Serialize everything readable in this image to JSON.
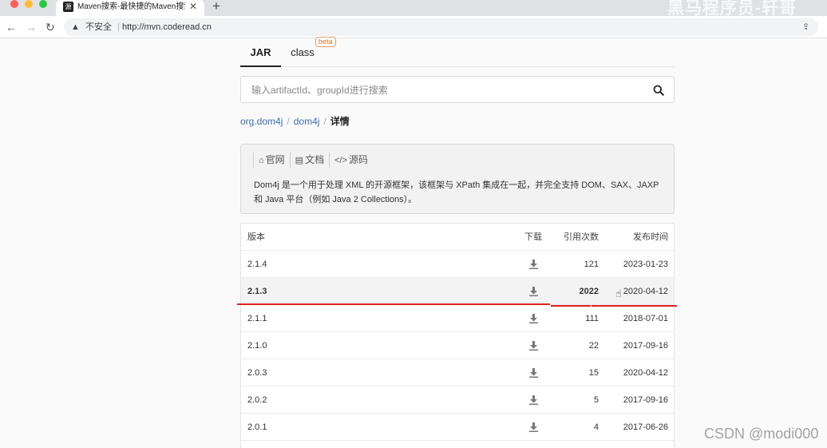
{
  "browser": {
    "tab_title": "Maven搜索-最快捷的Maven搜索",
    "tab_close": "✕",
    "new_tab": "+",
    "favicon": "源",
    "insecure_label": "不安全",
    "url": "http://mvn.coderead.cn",
    "url_sep": "|",
    "watermark_top": "黑马程序员-轩哥"
  },
  "tabs": {
    "jar": "JAR",
    "class": "class",
    "beta": "beta"
  },
  "search": {
    "placeholder": "输入artifactId、groupId进行搜索"
  },
  "breadcrumb": {
    "group": "org.dom4j",
    "sep1": "/",
    "artifact": "dom4j",
    "sep2": "/",
    "current": "详情"
  },
  "info": {
    "link_home": "官网",
    "link_docs": "文档",
    "link_source": "源码",
    "description": "Dom4j 是一个用于处理 XML 的开源框架，该框架与 XPath 集成在一起，并完全支持 DOM、SAX、JAXP 和 Java 平台（例如 Java 2 Collections）。"
  },
  "table": {
    "headers": {
      "version": "版本",
      "download": "下载",
      "count": "引用次数",
      "date": "发布时间"
    },
    "rows": [
      {
        "version": "2.1.4",
        "count": "121",
        "date": "2023-01-23"
      },
      {
        "version": "2.1.3",
        "count": "2022",
        "date": "2020-04-12"
      },
      {
        "version": "2.1.1",
        "count": "111",
        "date": "2018-07-01"
      },
      {
        "version": "2.1.0",
        "count": "22",
        "date": "2017-09-16"
      },
      {
        "version": "2.0.3",
        "count": "15",
        "date": "2020-04-12"
      },
      {
        "version": "2.0.2",
        "count": "5",
        "date": "2017-09-16"
      },
      {
        "version": "2.0.1",
        "count": "4",
        "date": "2017-06-26"
      }
    ]
  },
  "watermark_bottom": "CSDN @modi000",
  "colors": {
    "link": "#3d6db5",
    "annotation_red": "#e02020",
    "beta_orange": "#e0702b"
  }
}
